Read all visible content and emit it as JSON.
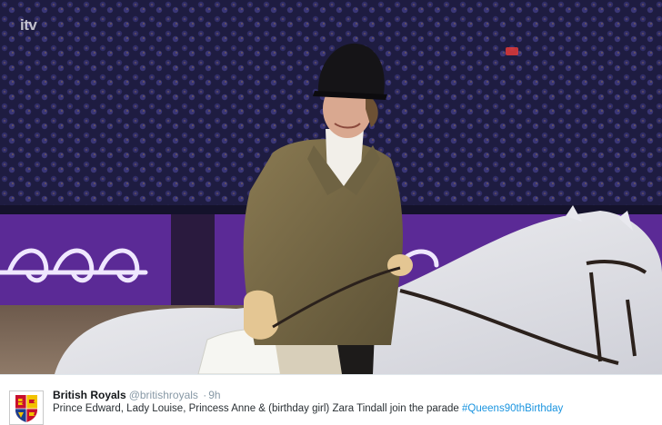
{
  "media": {
    "broadcaster_watermark": "itv"
  },
  "tweet": {
    "author_name": "British Royals",
    "handle": "@britishroyals",
    "separator": "·",
    "timestamp": "9h",
    "text": "Prince Edward, Lady Louise, Princess Anne & (birthday girl) Zara Tindall join the parade ",
    "hashtag": "#Queens90thBirthday"
  },
  "colors": {
    "link": "#1b95e0",
    "name": "#14171a",
    "meta": "#8899a6",
    "arena_banner": "#5b2a96"
  },
  "icons": {
    "avatar": "royal-coat-of-arms-icon"
  }
}
